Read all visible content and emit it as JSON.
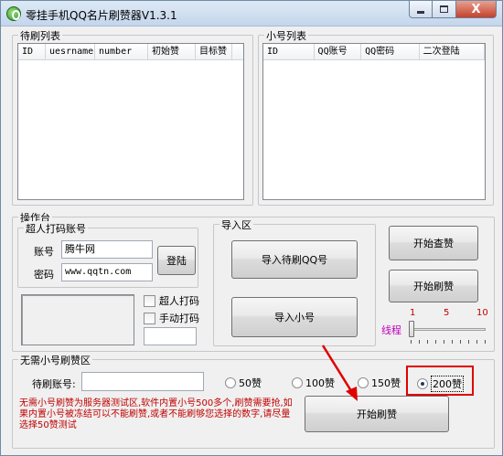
{
  "window": {
    "title": "零挂手机QQ名片刷赞器V1.3.1",
    "controls": {
      "close": "X"
    }
  },
  "pending_list": {
    "group_title": "待刷列表",
    "columns": [
      "ID",
      "uesrname",
      "number",
      "初始赞",
      "目标赞"
    ]
  },
  "account_list": {
    "group_title": "小号列表",
    "columns": [
      "ID",
      "QQ账号",
      "QQ密码",
      "二次登陆"
    ]
  },
  "console": {
    "group_title": "操作台",
    "captcha_account": {
      "group_title": "超人打码账号",
      "account_label": "账号",
      "account_value": "腾牛网",
      "password_label": "密码",
      "password_value": "www.qqtn.com",
      "login_button": "登陆"
    },
    "checkboxes": [
      {
        "label": "超人打码",
        "checked": false
      },
      {
        "label": "手动打码",
        "checked": false
      }
    ],
    "import_area": {
      "group_title": "导入区",
      "import_pending_button": "导入待刷QQ号",
      "import_accounts_button": "导入小号"
    },
    "start_query_button": "开始查赞",
    "start_like_button": "开始刷赞",
    "threads": {
      "label": "线程",
      "tick_labels": [
        "1",
        "5",
        "10"
      ],
      "value": 1
    }
  },
  "no_account_area": {
    "group_title": "无需小号刷赞区",
    "pending_account_label": "待刷账号:",
    "pending_account_value": "",
    "options": [
      {
        "label": "50赞",
        "selected": false
      },
      {
        "label": "100赞",
        "selected": false
      },
      {
        "label": "150赞",
        "selected": false
      },
      {
        "label": "200赞",
        "selected": true
      }
    ],
    "notice": "无需小号刷赞为服务器测试区,软件内置小号500多个,刷赞需要抢,如果内置小号被冻结可以不能刷赞,或者不能刷够您选择的数字,请尽量选择50赞测试",
    "start_button": "开始刷赞"
  },
  "colors": {
    "notice_text": "#c00000",
    "highlight": "#e00000",
    "thread_label": "#c000c0"
  }
}
